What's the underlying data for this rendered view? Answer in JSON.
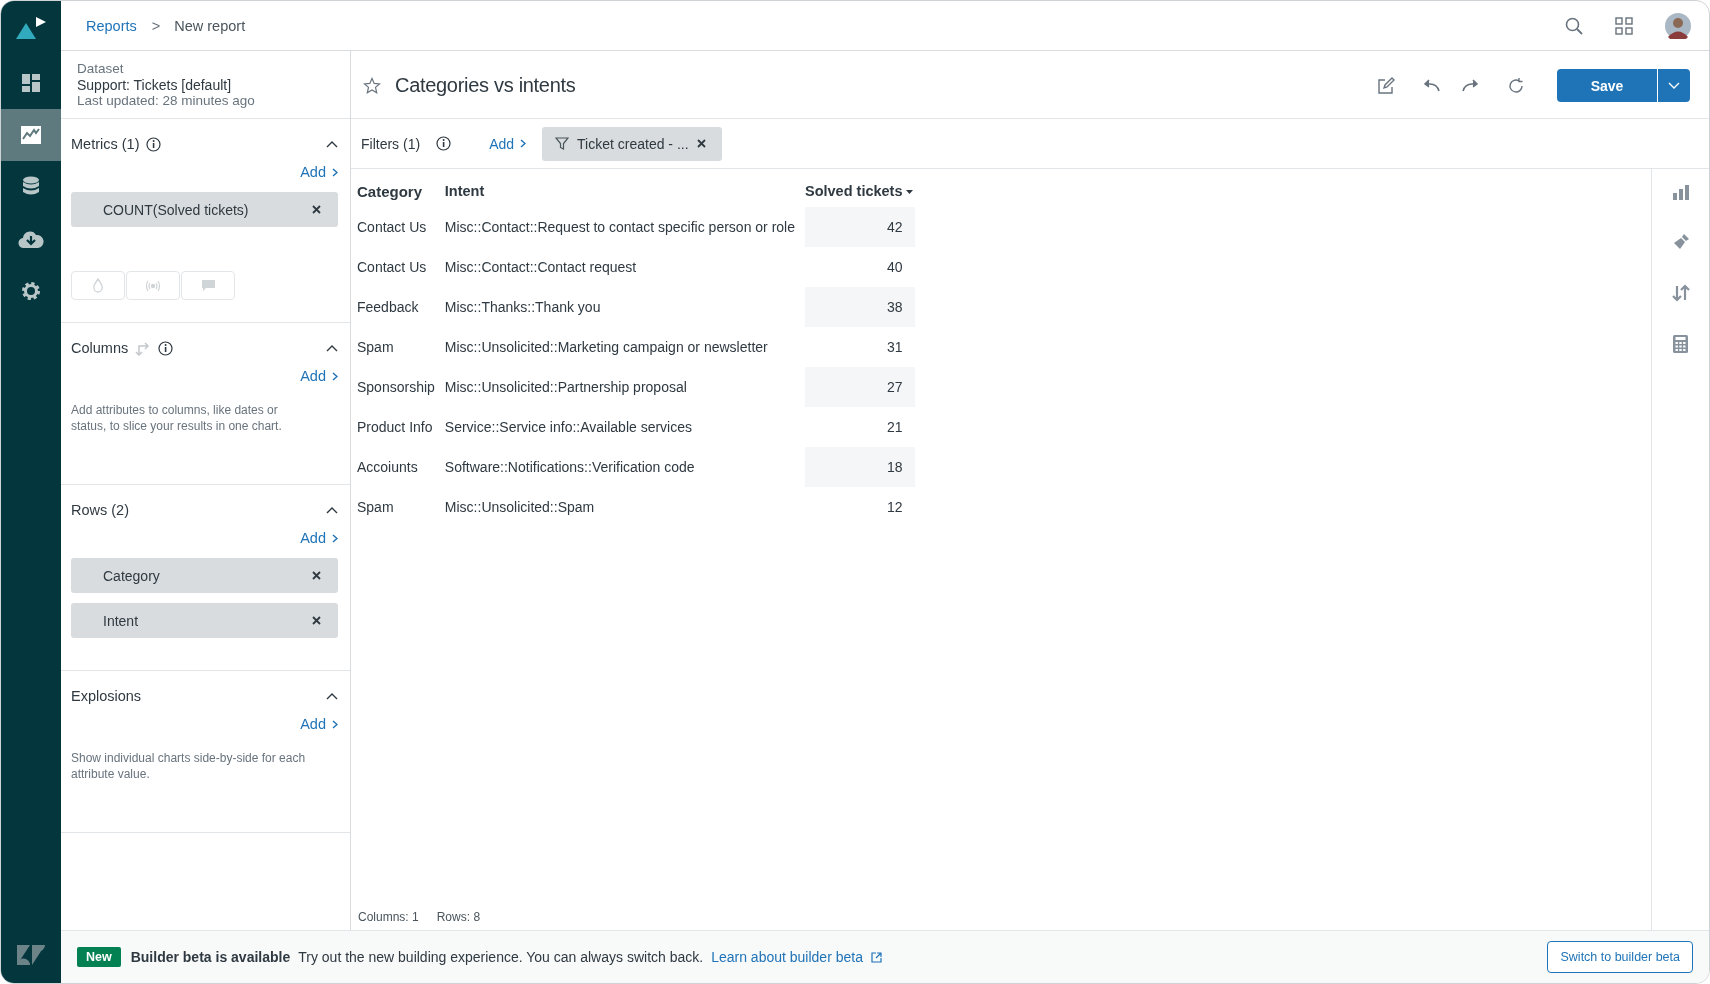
{
  "rail": [
    {
      "kind": "dashboard",
      "selected": false
    },
    {
      "kind": "reports",
      "selected": true
    },
    {
      "kind": "datasets",
      "selected": false
    },
    {
      "kind": "download",
      "selected": false
    },
    {
      "kind": "settings",
      "selected": false
    }
  ],
  "breadcrumb": {
    "link": "Reports",
    "separator": ">",
    "current": "New report"
  },
  "dataset": {
    "label": "Dataset",
    "name": "Support: Tickets [default]",
    "updated": "Last updated: 28 minutes ago"
  },
  "sections": [
    {
      "title": "Metrics (1)",
      "swap": false,
      "info": true,
      "expanded": true,
      "add": "Add",
      "chips": [
        "COUNT(Solved tickets)"
      ],
      "tools": [
        {
          "kind": "drop"
        },
        {
          "kind": "signal"
        },
        {
          "kind": "comment"
        }
      ]
    },
    {
      "title": "Columns",
      "swap": true,
      "info": true,
      "expanded": true,
      "add": "Add",
      "hint": "Add attributes to columns, like dates or status, to slice your results in one chart."
    },
    {
      "title": "Rows (2)",
      "swap": false,
      "info": false,
      "expanded": true,
      "add": "Add",
      "chips": [
        "Category",
        "Intent"
      ]
    },
    {
      "title": "Explosions",
      "swap": false,
      "info": false,
      "expanded": true,
      "add": "Add",
      "hint": "Show individual charts side-by-side for each attribute value."
    }
  ],
  "report": {
    "title": "Categories vs intents",
    "starred": false,
    "save": "Save"
  },
  "filters": {
    "title": "Filters (1)",
    "add": "Add",
    "chips": [
      "Ticket created - ..."
    ]
  },
  "table": {
    "columns": [
      {
        "label": "Category",
        "sorted": false
      },
      {
        "label": "Intent",
        "sorted": false
      },
      {
        "label": "Solved tickets",
        "sorted": true
      }
    ],
    "rows": [
      [
        "Contact Us",
        "Misc::Contact::Request to contact specific person or role",
        "42"
      ],
      [
        "Contact Us",
        "Misc::Contact::Contact request",
        "40"
      ],
      [
        "Feedback",
        "Misc::Thanks::Thank you",
        "38"
      ],
      [
        "Spam",
        "Misc::Unsolicited::Marketing campaign or newsletter",
        "31"
      ],
      [
        "Sponsorship",
        "Misc::Unsolicited::Partnership proposal",
        "27"
      ],
      [
        "Product Info",
        "Service::Service info::Available services",
        "21"
      ],
      [
        "Accoiunts",
        "Software::Notifications::Verification code",
        "18"
      ],
      [
        "Spam",
        "Misc::Unsolicited::Spam",
        "12"
      ]
    ]
  },
  "summary": [
    "Columns: 1",
    "Rows: 8"
  ],
  "banner": {
    "badge": "New",
    "title": "Builder beta is available",
    "text": "Try out the new building experience. You can always switch back.",
    "link": "Learn about builder beta",
    "button": "Switch to builder beta"
  }
}
